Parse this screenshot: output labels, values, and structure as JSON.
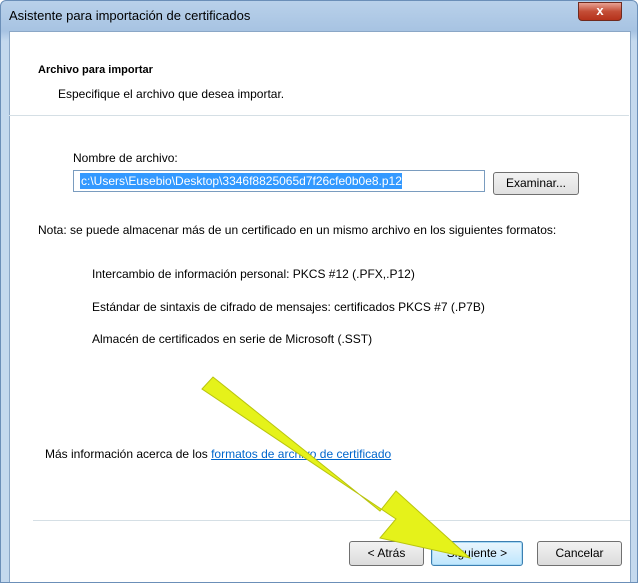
{
  "window": {
    "title": "Asistente para importación de certificados",
    "close_label": "x"
  },
  "header": {
    "title": "Archivo para importar",
    "description": "Especifique el archivo que desea importar."
  },
  "file": {
    "label": "Nombre de archivo:",
    "value": "c:\\Users\\Eusebio\\Desktop\\3346f8825065d7f26cfe0b0e8.p12",
    "browse_label": "Examinar..."
  },
  "note": {
    "text": "Nota: se puede almacenar más de un certificado en un mismo archivo en los siguientes formatos:",
    "formats": [
      "Intercambio de información personal: PKCS #12 (.PFX,.P12)",
      "Estándar de sintaxis de cifrado de mensajes: certificados PKCS #7 (.P7B)",
      "Almacén de certificados en serie de Microsoft (.SST)"
    ]
  },
  "more_info": {
    "prefix": "Más información acerca de los ",
    "link": "formatos de archivo de certificado"
  },
  "buttons": {
    "back": "< Atrás",
    "next": "Siguiente >",
    "cancel": "Cancelar"
  },
  "colors": {
    "arrow": "#e5f21a",
    "accent": "#3399ff",
    "link": "#0066cc"
  }
}
